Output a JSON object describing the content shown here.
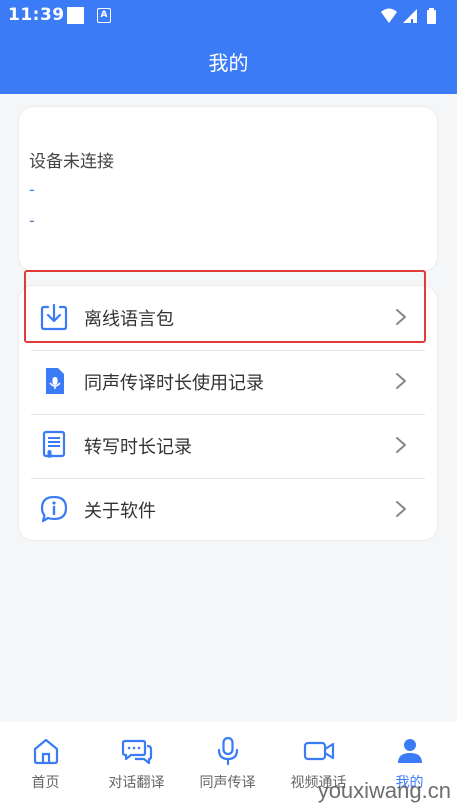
{
  "status_bar": {
    "time": "11:39",
    "a_badge": "A"
  },
  "header": {
    "title": "我的"
  },
  "device": {
    "status": "设备未连接",
    "line1": "-",
    "line2": "-"
  },
  "menu": {
    "items": [
      {
        "label": "离线语言包",
        "icon": "download-icon"
      },
      {
        "label": "同声传译时长使用记录",
        "icon": "document-mic-icon"
      },
      {
        "label": "转写时长记录",
        "icon": "transcript-icon"
      },
      {
        "label": "关于软件",
        "icon": "info-chat-icon"
      }
    ]
  },
  "tabs": [
    {
      "label": "首页",
      "icon": "home-icon"
    },
    {
      "label": "对话翻译",
      "icon": "chat-icon"
    },
    {
      "label": "同声传译",
      "icon": "microphone-icon"
    },
    {
      "label": "视频通话",
      "icon": "video-icon"
    },
    {
      "label": "我的",
      "icon": "user-icon",
      "active": true
    }
  ],
  "watermark": "youxiwang.cn",
  "colors": {
    "primary": "#3b7bf6",
    "highlight": "#e03a3a"
  }
}
